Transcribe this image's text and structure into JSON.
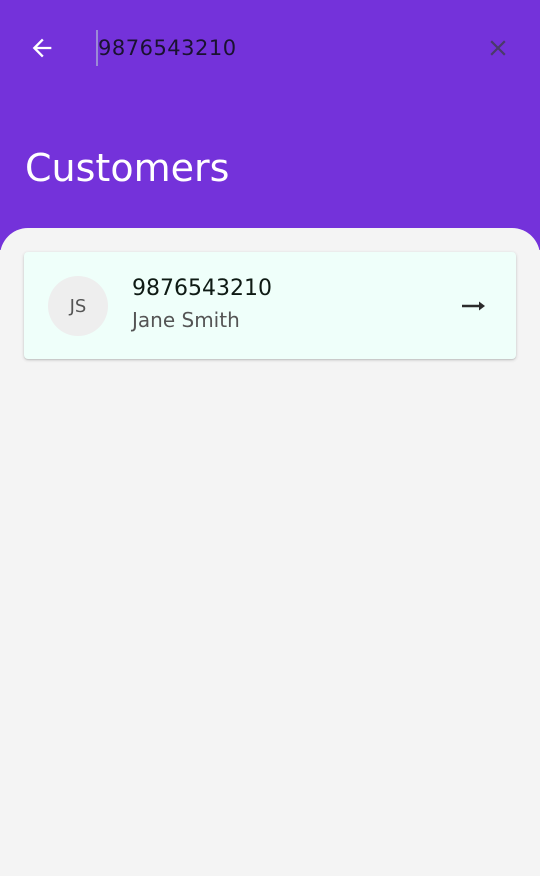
{
  "search": {
    "value": "9876543210"
  },
  "header": {
    "title": "Customers"
  },
  "results": [
    {
      "initials": "JS",
      "phone": "9876543210",
      "name": "Jane Smith"
    }
  ],
  "colors": {
    "header_bg": "#7432da",
    "page_bg": "#f4f4f4",
    "card_bg": "#effffa"
  },
  "icons": {
    "back": "arrow-left-icon",
    "clear": "close-icon",
    "open": "arrow-right-icon"
  }
}
